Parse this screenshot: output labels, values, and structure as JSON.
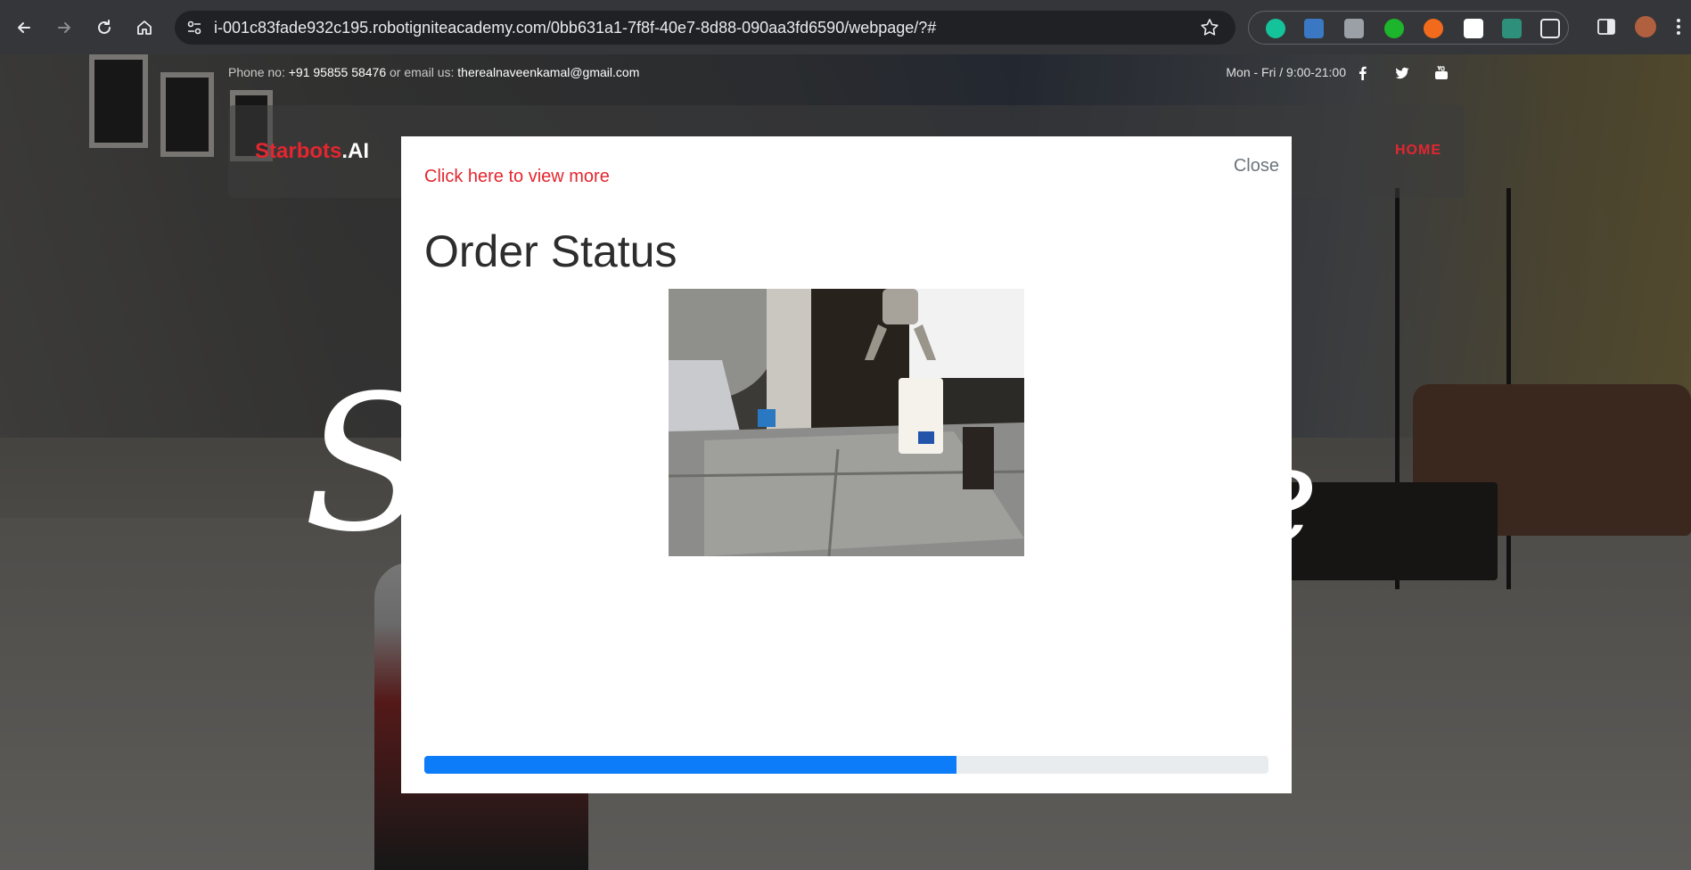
{
  "browser": {
    "url": "i-001c83fade932c195.robotigniteacademy.com/0bb631a1-7f8f-40e7-8d88-090aa3fd6590/webpage/?#",
    "extensions": [
      "grammarly-icon",
      "puzzle-blue-icon",
      "clipboard-icon",
      "green-circle-icon",
      "orange-fox-icon",
      "glasses-icon",
      "s-green-icon",
      "extensions-icon"
    ]
  },
  "site": {
    "topbar": {
      "phone_label": "Phone no:",
      "phone": "+91 95855 58476",
      "email_label": "or email us:",
      "email": "therealnaveenkamal@gmail.com",
      "hours": "Mon - Fri / 9:00-21:00"
    },
    "brand": {
      "part1": "Starbots",
      "part2": ".AI"
    },
    "nav": {
      "home": "HOME"
    },
    "hero": {
      "left": "S",
      "right": "e"
    }
  },
  "modal": {
    "close_label": "Close",
    "link_label": "Click here to view more",
    "title": "Order Status",
    "progress": 0.63
  },
  "colors": {
    "accent_red": "#e3262f",
    "progress_blue": "#0d7cf8"
  }
}
